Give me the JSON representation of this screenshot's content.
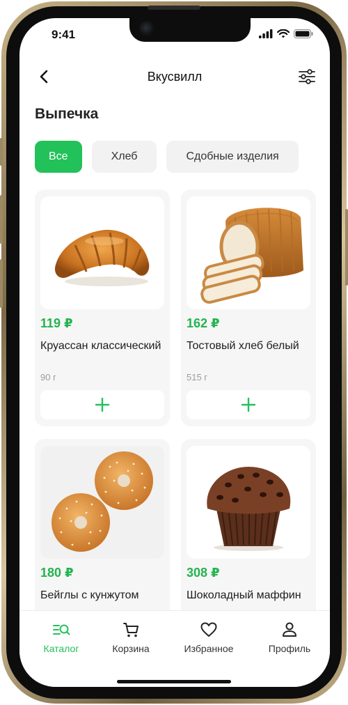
{
  "status_bar": {
    "time": "9:41"
  },
  "header": {
    "title": "Вкусвилл"
  },
  "section": {
    "title": "Выпечка"
  },
  "chips": [
    {
      "label": "Все",
      "active": true
    },
    {
      "label": "Хлеб",
      "active": false
    },
    {
      "label": "Сдобные изделия",
      "active": false
    }
  ],
  "products": [
    {
      "price": "119 ₽",
      "name": "Круассан классический",
      "weight": "90 г",
      "image": "croissant"
    },
    {
      "price": "162 ₽",
      "name": "Тостовый хлеб белый",
      "weight": "515 г",
      "image": "sliced-bread"
    },
    {
      "price": "180 ₽",
      "name": "Бейглы с кунжутом",
      "weight": "",
      "image": "bagels"
    },
    {
      "price": "308 ₽",
      "name": "Шоколадный маффин",
      "weight": "",
      "image": "muffin"
    }
  ],
  "bottom_nav": {
    "items": [
      {
        "label": "Каталог",
        "icon": "catalog-search-icon",
        "active": true
      },
      {
        "label": "Корзина",
        "icon": "cart-icon",
        "active": false
      },
      {
        "label": "Избранное",
        "icon": "heart-icon",
        "active": false
      },
      {
        "label": "Профиль",
        "icon": "person-icon",
        "active": false
      }
    ]
  },
  "colors": {
    "accent": "#23c15a",
    "price": "#23b34f",
    "chip_bg": "#f2f2f2",
    "card_bg": "#f6f6f6"
  }
}
